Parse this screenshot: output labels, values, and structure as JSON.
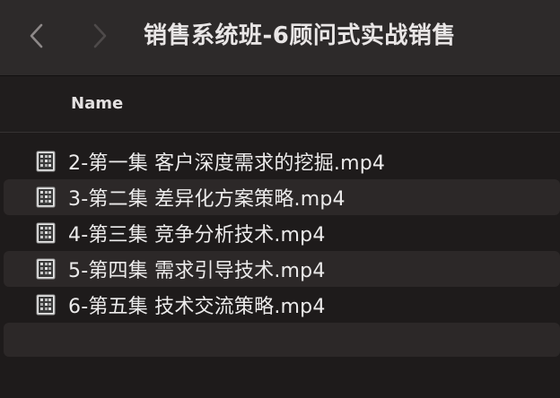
{
  "window": {
    "title": "销售系统班-6顾问式实战销售",
    "back_icon": "chevron-left-icon",
    "forward_icon": "chevron-right-icon"
  },
  "columns": {
    "name_header": "Name"
  },
  "files": [
    {
      "name": "2-第一集 客户深度需求的挖掘.mp4",
      "icon": "video-file-icon"
    },
    {
      "name": "3-第二集 差异化方案策略.mp4",
      "icon": "video-file-icon"
    },
    {
      "name": "4-第三集 竞争分析技术.mp4",
      "icon": "video-file-icon"
    },
    {
      "name": "5-第四集 需求引导技术.mp4",
      "icon": "video-file-icon"
    },
    {
      "name": "6-第五集 技术交流策略.mp4",
      "icon": "video-file-icon"
    }
  ],
  "colors": {
    "titlebar": "#2d2a2a",
    "background": "#1e1b1b",
    "alt_row": "#2c2828",
    "text": "#ecebeb"
  }
}
